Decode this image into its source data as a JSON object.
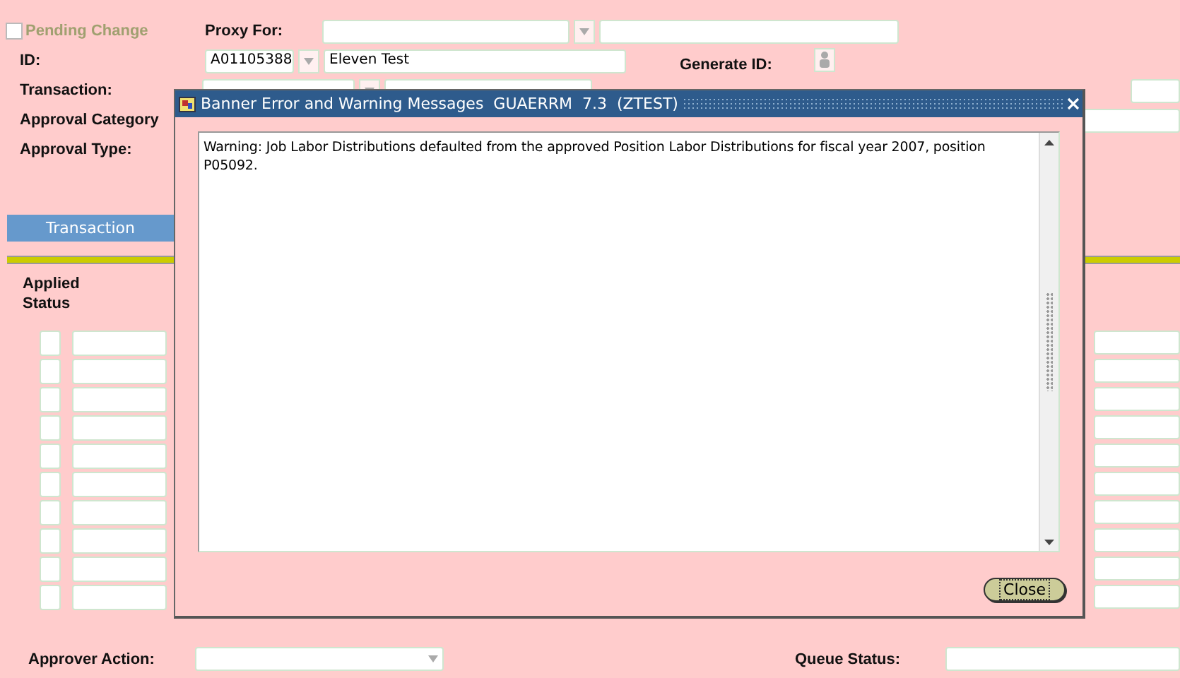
{
  "form": {
    "pending_change": {
      "label": "Pending Change",
      "checked": false,
      "disabled": true
    },
    "proxy_for": {
      "label": "Proxy For:"
    },
    "id": {
      "label": "ID:",
      "value": "A01105388",
      "name": "Eleven Test"
    },
    "generate_id": {
      "label": "Generate ID:"
    },
    "transaction": {
      "label": "Transaction:"
    },
    "approval_category": {
      "label": "Approval Category"
    },
    "approval_type": {
      "label": "Approval Type:"
    }
  },
  "tab": {
    "label": "Transaction",
    "selected": true
  },
  "grid": {
    "column_label": "Applied Status"
  },
  "approver_action": {
    "label": "Approver Action:"
  },
  "queue_status": {
    "label": "Queue Status:"
  },
  "dialog": {
    "title": "Banner Error and Warning Messages  GUAERRM  7.3  (ZTEST)",
    "message": "Warning: Job Labor Distributions defaulted from the approved Position Labor Distributions for fiscal year 2007, position P05092.",
    "close_button": "Close"
  }
}
